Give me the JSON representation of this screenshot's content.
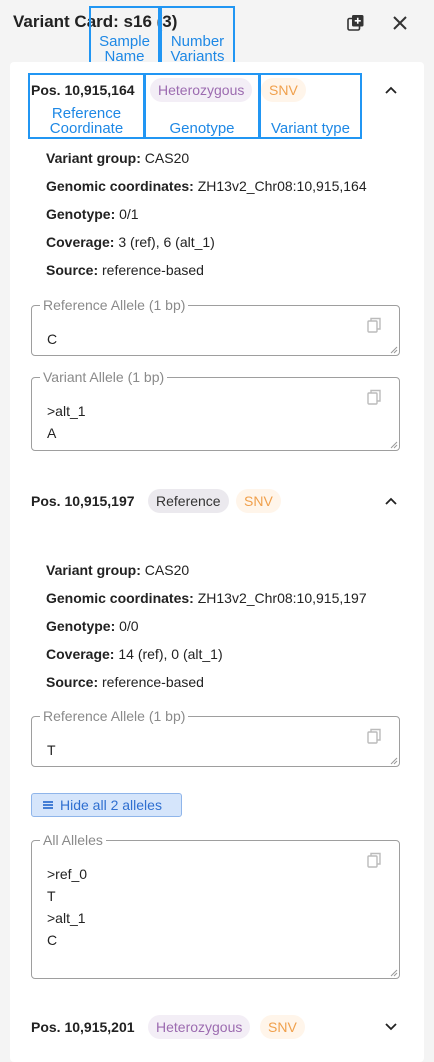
{
  "header": {
    "title": "Variant Card: s16 (3)",
    "actions": [
      {
        "name": "copy-all-icon"
      },
      {
        "name": "close-icon"
      }
    ]
  },
  "annotations": {
    "sample_name": "Sample Name",
    "number_variants": "Number Variants",
    "reference_coordinate": "Reference Coordinate",
    "genotype": "Genotype",
    "variant_type": "Variant type"
  },
  "variants": [
    {
      "position": "Pos. 10,915,164",
      "genotype_chip": "Heterozygous",
      "type_chip": "SNV",
      "expanded": true,
      "details": [
        {
          "key": "Variant group:",
          "value": "CAS20"
        },
        {
          "key": "Genomic coordinates:",
          "value": "ZH13v2_Chr08:10,915,164"
        },
        {
          "key": "Genotype:",
          "value": "0/1"
        },
        {
          "key": "Coverage:",
          "value": "3 (ref), 6 (alt_1)"
        },
        {
          "key": "Source:",
          "value": "reference-based"
        }
      ],
      "fields": [
        {
          "label": "Reference Allele (1 bp)",
          "lines": [
            "C"
          ]
        },
        {
          "label": "Variant Allele (1 bp)",
          "lines": [
            ">alt_1",
            "A"
          ]
        }
      ]
    },
    {
      "position": "Pos. 10,915,197",
      "genotype_chip": "Reference",
      "type_chip": "SNV",
      "expanded": true,
      "details": [
        {
          "key": "Variant group:",
          "value": "CAS20"
        },
        {
          "key": "Genomic coordinates:",
          "value": "ZH13v2_Chr08:10,915,197"
        },
        {
          "key": "Genotype:",
          "value": "0/0"
        },
        {
          "key": "Coverage:",
          "value": "14 (ref), 0 (alt_1)"
        },
        {
          "key": "Source:",
          "value": "reference-based"
        }
      ],
      "fields": [
        {
          "label": "Reference Allele (1 bp)",
          "lines": [
            "T"
          ]
        },
        {
          "label": "All Alleles",
          "lines": [
            ">ref_0",
            "T",
            ">alt_1",
            "C"
          ]
        }
      ],
      "toggle_label": "Hide all 2 alleles"
    },
    {
      "position": "Pos. 10,915,201",
      "genotype_chip": "Heterozygous",
      "type_chip": "SNV",
      "expanded": false
    }
  ],
  "colors": {
    "annotation": "#2196f3",
    "heterozygous_chip_bg": "#f3eef6",
    "heterozygous_chip_text": "#9c6bb0",
    "reference_chip_bg": "#ebe9ee",
    "snv_chip_bg": "#fff5ea",
    "snv_chip_text": "#f0a04c",
    "toggle_bg": "#d5e5fb",
    "toggle_text": "#2f6fd0"
  }
}
